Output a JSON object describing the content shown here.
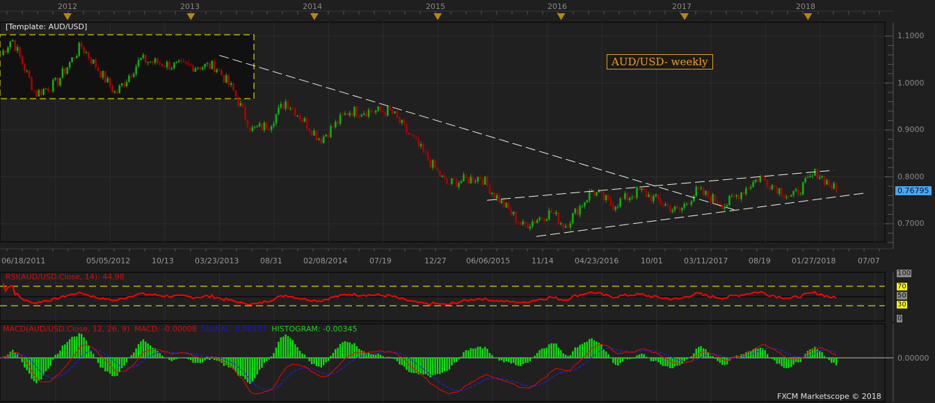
{
  "header": {
    "years": [
      "2012",
      "2013",
      "2014",
      "2015",
      "2016",
      "2017",
      "2018"
    ]
  },
  "main": {
    "template_label": "[Template: AUD/USD]",
    "title": "AUD/USD- weekly",
    "current_price": "0.76795",
    "price_ticks": [
      "1.1000",
      "1.0000",
      "0.9000",
      "0.8000",
      "0.7000"
    ],
    "date_ticks": [
      "06/18/2011",
      "05/05/2012",
      "10/13",
      "03/23/2013",
      "08/31",
      "02/08/2014",
      "07/19",
      "12/27",
      "06/06/2015",
      "11/14",
      "04/23/2016",
      "10/01",
      "03/11/2017",
      "08/19",
      "01/27/2018",
      "07/07"
    ]
  },
  "rsi": {
    "title": "RSI(AUD/USD.Close, 14): 44.98",
    "levels": [
      "100",
      "70",
      "50",
      "30",
      "0"
    ]
  },
  "macd": {
    "title": "MACD(AUD/USD.Close, 12, 26, 9)",
    "macd": "MACD: -0.00008",
    "signal": "SIGNAL: 0.00337",
    "histogram": "HISTOGRAM: -0.00345",
    "zero_label": "0.00000"
  },
  "footer": "FXCM Marketscope © 2018",
  "colors": {
    "up": "#10b010",
    "down": "#b00000",
    "rsi": "#ff0000",
    "macd": "#ff0000",
    "signal": "#2020ff",
    "hist": "#10e010",
    "level": "#ffff00",
    "accent": "#f0a020"
  },
  "chart_data": {
    "type": "candlestick",
    "title": "AUD/USD- weekly",
    "ylim": [
      0.65,
      1.12
    ],
    "xlabel": "",
    "ylabel": "",
    "close_anchors": {
      "year": [
        2011.46,
        2011.55,
        2011.74,
        2011.91,
        2012.11,
        2012.39,
        2012.59,
        2012.87,
        2013.2,
        2013.34,
        2013.49,
        2013.63,
        2013.77,
        2014.05,
        2014.28,
        2014.62,
        2014.84,
        2015.07,
        2015.35,
        2015.46,
        2015.69,
        2015.92,
        2016.03,
        2016.25,
        2016.42,
        2016.64,
        2016.95,
        2017.1,
        2017.33,
        2017.61,
        2017.87,
        2018.07,
        2018.24
      ],
      "close": [
        1.06,
        1.095,
        0.977,
        1.0,
        1.08,
        0.977,
        1.05,
        1.036,
        1.036,
        0.985,
        0.9,
        0.91,
        0.962,
        0.88,
        0.94,
        0.94,
        0.866,
        0.785,
        0.8,
        0.762,
        0.695,
        0.725,
        0.695,
        0.77,
        0.74,
        0.77,
        0.725,
        0.77,
        0.74,
        0.8,
        0.755,
        0.81,
        0.768
      ]
    },
    "trendlines": [
      {
        "name": "downtrend",
        "from": [
          2013.23,
          1.059
        ],
        "to": [
          2017.4,
          0.73
        ]
      },
      {
        "name": "channel-upper",
        "from": [
          2015.4,
          0.75
        ],
        "to": [
          2018.21,
          0.814
        ]
      },
      {
        "name": "channel-lower",
        "from": [
          2015.8,
          0.673
        ],
        "to": [
          2018.48,
          0.766
        ]
      }
    ],
    "rsi_period": 14,
    "macd_params": [
      12,
      26,
      9
    ]
  }
}
